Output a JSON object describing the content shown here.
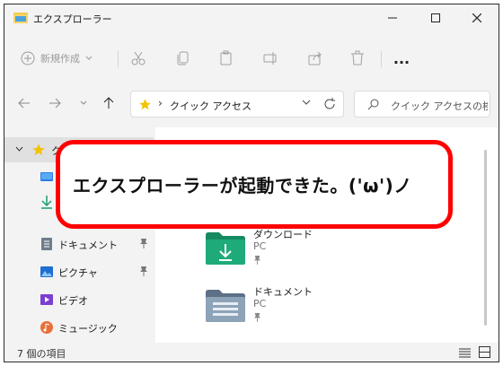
{
  "window": {
    "title": "エクスプローラー",
    "minimize_icon": "minimize-icon",
    "maximize_icon": "maximize-icon",
    "close_icon": "close-icon"
  },
  "toolbar": {
    "new_label": "新規作成",
    "icons": [
      "cut-icon",
      "copy-icon",
      "paste-icon",
      "rename-icon",
      "share-icon",
      "delete-icon",
      "more-icon"
    ],
    "more_label": "..."
  },
  "nav": {
    "address_text": "クイック アクセス",
    "search_placeholder": "クイック アクセスの検..."
  },
  "sidebar": {
    "items": [
      {
        "label": "ク",
        "icon": "star-icon"
      },
      {
        "label": "",
        "icon": "desktop-icon"
      },
      {
        "label": "",
        "icon": "download-icon"
      },
      {
        "label": "ドキュメント",
        "icon": "document-icon"
      },
      {
        "label": "ピクチャ",
        "icon": "picture-icon"
      },
      {
        "label": "ビデオ",
        "icon": "video-icon"
      },
      {
        "label": "ミュージック",
        "icon": "music-icon"
      }
    ]
  },
  "folders": [
    {
      "name": "ダウンロード",
      "location": "PC",
      "icon": "download-folder-icon"
    },
    {
      "name": "ドキュメント",
      "location": "PC",
      "icon": "document-folder-icon"
    }
  ],
  "status": {
    "item_count": "7 個の項目"
  },
  "callout": {
    "text": "エクスプローラーが起動できた。('ω')ノ"
  },
  "colors": {
    "accent": "#0067c0",
    "callout_border": "#ff0000",
    "folder_green": "#1a9e6d",
    "star": "#f2c200"
  }
}
